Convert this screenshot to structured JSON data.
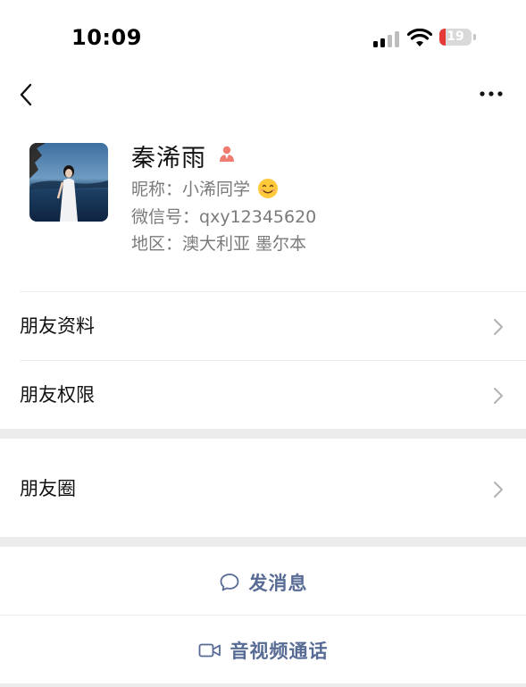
{
  "status_bar": {
    "time": "10:09",
    "battery": "19",
    "battery_level": 0.19
  },
  "profile": {
    "name": "秦浠雨",
    "nickname_label": "昵称：",
    "nickname": "小浠同学",
    "wechat_id_label": "微信号：",
    "wechat_id": "qxy12345620",
    "region_label": "地区：",
    "region": "澳大利亚 墨尔本"
  },
  "rows": {
    "friend_info": "朋友资料",
    "friend_permissions": "朋友权限",
    "moments": "朋友圈"
  },
  "actions": {
    "send_message": "发消息",
    "video_call": "音视频通话"
  },
  "colors": {
    "action_text": "#576b95",
    "gender_icon": "#f07b6f",
    "separator": "#ececec"
  }
}
